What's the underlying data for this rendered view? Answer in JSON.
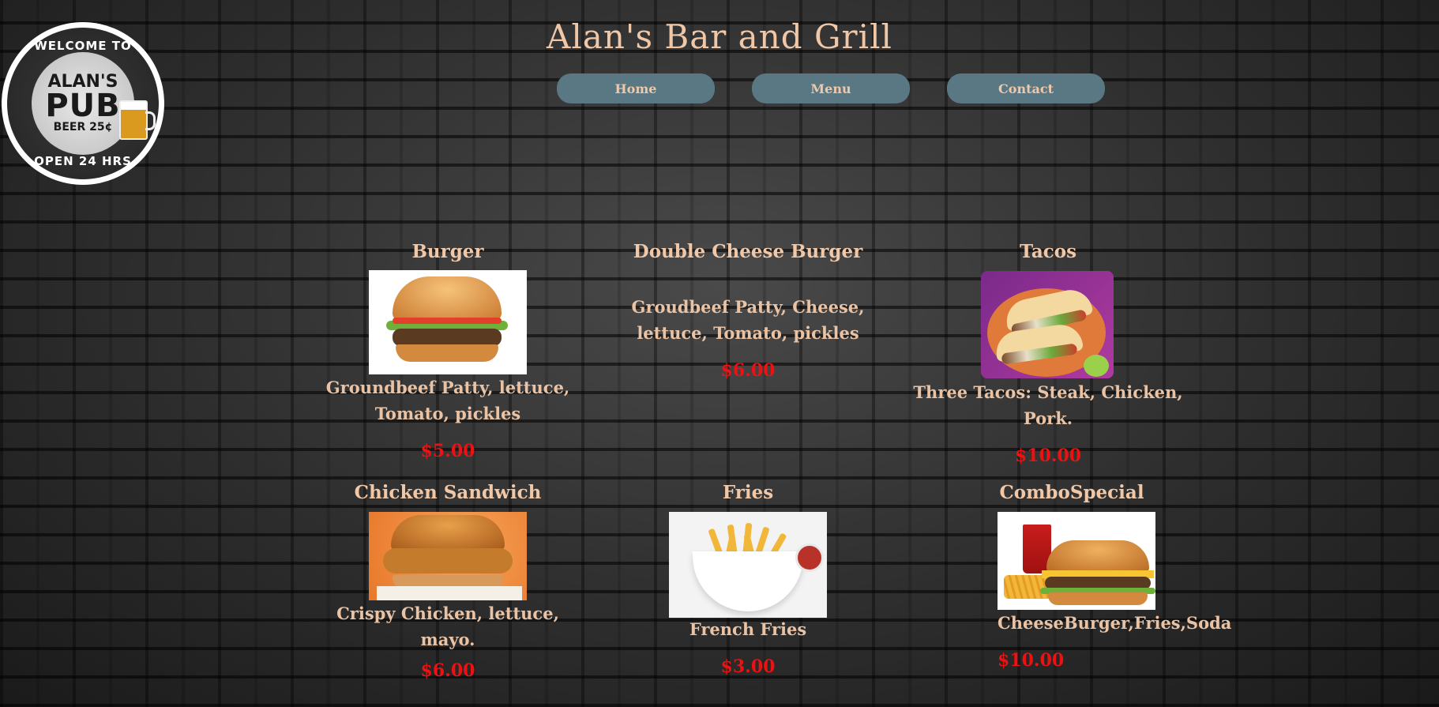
{
  "logo": {
    "top_text": "WELCOME TO",
    "line1": "ALAN'S",
    "line2": "PUB",
    "line3": "BEER 25¢",
    "bottom_text": "OPEN 24 HRS"
  },
  "header": {
    "title": "Alan's Bar and Grill"
  },
  "nav": {
    "home": "Home",
    "menu": "Menu",
    "contact": "Contact"
  },
  "menu": {
    "burger": {
      "name": "Burger",
      "desc": "Groundbeef Patty, lettuce, Tomato, pickles",
      "price": "$5.00"
    },
    "double_cheese_burger": {
      "name": "Double Cheese Burger",
      "desc": "Groudbeef Patty, Cheese, lettuce, Tomato, pickles",
      "price": "$6.00"
    },
    "tacos": {
      "name": "Tacos",
      "desc": "Three Tacos: Steak, Chicken, Pork.",
      "price": "$10.00"
    },
    "chicken_sandwich": {
      "name": "Chicken Sandwich",
      "desc": "Crispy Chicken, lettuce, mayo.",
      "price": "$6.00"
    },
    "fries": {
      "name": "Fries",
      "desc": "French Fries",
      "price": "$3.00"
    },
    "combo_special": {
      "name": "ComboSpecial",
      "desc": "CheeseBurger,Fries,Soda",
      "price": "$10.00"
    }
  },
  "colors": {
    "accent_text": "#f0c8a8",
    "price": "#ee1111",
    "nav_button": "#5a7883"
  }
}
